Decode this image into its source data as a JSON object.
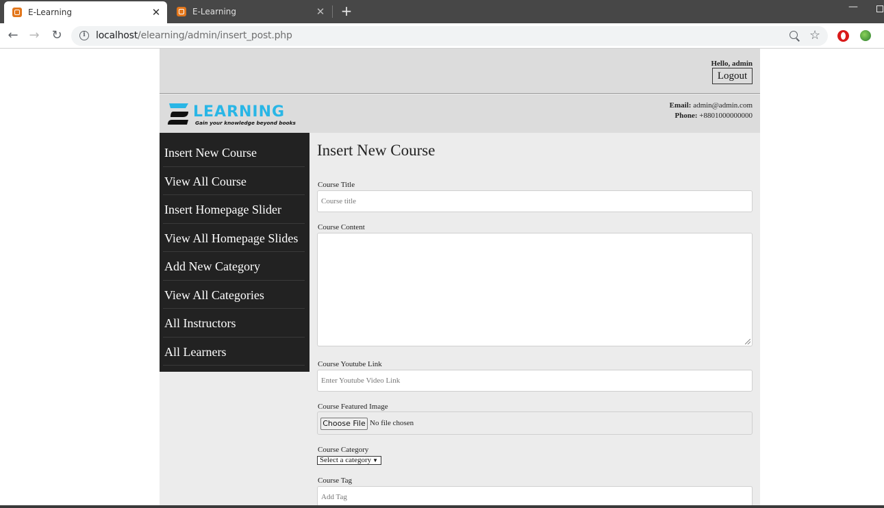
{
  "browser": {
    "tabs": [
      {
        "title": "E-Learning",
        "active": true
      },
      {
        "title": "E-Learning",
        "active": false
      }
    ],
    "url_host": "localhost",
    "url_path": "/elearning/admin/insert_post.php"
  },
  "header": {
    "greeting": "Hello, admin",
    "logout_label": "Logout",
    "logo_word": "LEARNING",
    "logo_tagline": "Gain your knowledge beyond books",
    "email_label": "Email:",
    "email_value": "admin@admin.com",
    "phone_label": "Phone:",
    "phone_value": "+8801000000000"
  },
  "sidebar": {
    "items": [
      {
        "label": "Insert New Course"
      },
      {
        "label": "View All Course"
      },
      {
        "label": "Insert Homepage Slider"
      },
      {
        "label": "View All Homepage Slides"
      },
      {
        "label": "Add New Category"
      },
      {
        "label": "View All Categories"
      },
      {
        "label": "All Instructors"
      },
      {
        "label": "All Learners"
      }
    ]
  },
  "form": {
    "heading": "Insert New Course",
    "title_label": "Course Title",
    "title_placeholder": "Course title",
    "content_label": "Course Content",
    "youtube_label": "Course Youtube Link",
    "youtube_placeholder": "Enter Youtube Video Link",
    "image_label": "Course Featured Image",
    "choose_file_label": "Choose File",
    "file_status": "No file chosen",
    "category_label": "Course Category",
    "category_selected": "Select a category",
    "tag_label": "Course Tag",
    "tag_placeholder": "Add Tag"
  },
  "colors": {
    "sidebar_bg": "#222222",
    "header_bg": "#dcdcdc",
    "content_bg": "#ececec",
    "logo_accent": "#29b6e6"
  }
}
